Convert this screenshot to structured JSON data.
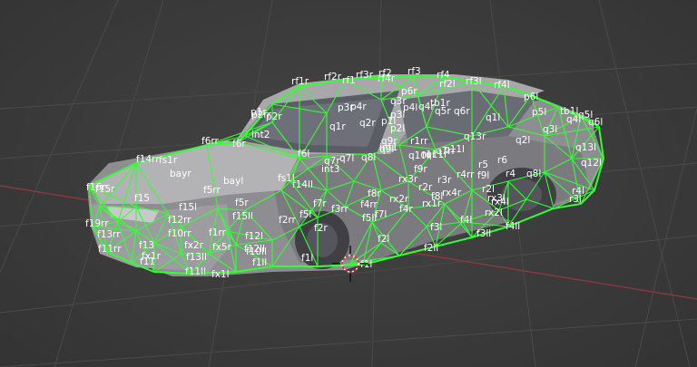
{
  "viewport": {
    "background": "#3c3c3c",
    "grid_color": "#4a4a4a",
    "x_axis_color": "#9a3b3b",
    "wire_color": "#33ff33",
    "body_color": "#8f8f93",
    "label_color": "#ffffff",
    "cursor_icon": "3d-cursor-icon"
  },
  "vertex_labels": [
    "rf2r",
    "rf1",
    "rf3r",
    "rf2",
    "rf4r",
    "rf3",
    "rf4",
    "rf2l",
    "rf3l",
    "rf4l",
    "rf1r",
    "p6l",
    "p5l",
    "tb1l",
    "q4l",
    "q5l",
    "q6l",
    "p1r",
    "p2r",
    "p2rr",
    "p3r",
    "p4r",
    "q1r",
    "q2r",
    "p1l",
    "p2l",
    "p3l",
    "p4l",
    "q3r",
    "p6r",
    "tb1r",
    "q4r",
    "q5r",
    "q6r",
    "q1l",
    "q2l",
    "q3l",
    "q13l",
    "q13r",
    "q12l",
    "int2",
    "int1",
    "int3",
    "q7l",
    "q7r",
    "q8l",
    "q9r",
    "q9l",
    "q10r",
    "q11r",
    "q11l",
    "r1rr",
    "r1r",
    "r2r",
    "r3r",
    "r5",
    "r6",
    "r4rr",
    "r4",
    "r2l",
    "r3l",
    "r4l",
    "f14rr",
    "fs1r",
    "f6rr",
    "f6r",
    "f6l",
    "bayr",
    "bayl",
    "fs1l",
    "f14ll",
    "f16r",
    "f15r",
    "f15",
    "f5rr",
    "f5r",
    "f15l",
    "f15ll",
    "f12rr",
    "f12l",
    "f12ll",
    "f19rr",
    "f13rr",
    "f11rr",
    "f13",
    "fx1r",
    "f11",
    "f10rr",
    "fx2r",
    "fx5r",
    "f13ll",
    "f11ll",
    "fx1l",
    "f1rr",
    "f10ll",
    "f1ll",
    "f2rr",
    "f5l",
    "f7r",
    "f3rr",
    "f2r",
    "f8r",
    "f4rr",
    "f7l",
    "f4r",
    "f5ll",
    "rx3r",
    "rx2r",
    "rx1r",
    "f9r",
    "f8l",
    "f9l",
    "f3l",
    "f4l",
    "f2l",
    "f2ll",
    "f3ll",
    "f4ll",
    "rx4r",
    "rx3l",
    "rx2l",
    "rx4l",
    "q7rr",
    "q8l",
    "f1l",
    "f1l"
  ]
}
